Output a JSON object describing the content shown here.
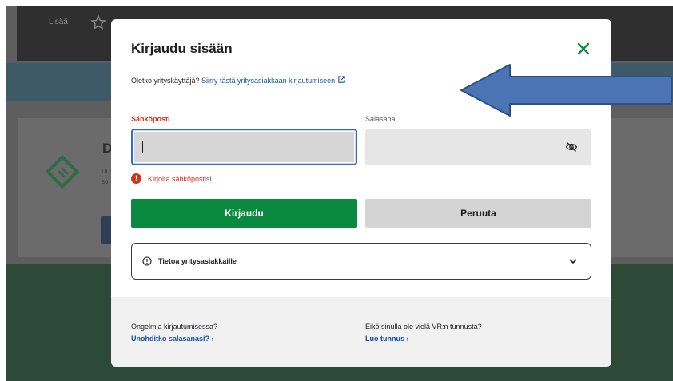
{
  "background": {
    "nav_label": "Lisää",
    "card_title": "D",
    "card_text": "Ui Eu so"
  },
  "modal": {
    "title": "Kirjaudu sisään",
    "close_icon": "close-x-icon",
    "business_prompt": "Oletko yrityskäyttäjä?",
    "business_link": "Siirry tästä yritysasiakkaan kirjautumiseen",
    "email_label": "Sähköposti",
    "email_value": "",
    "password_label": "Salasana",
    "password_value": "",
    "error_message": "Kirjoita sähköpostisi",
    "login_button": "Kirjaudu",
    "cancel_button": "Peruuta",
    "info_label": "Tietoa yritysasiakkaille",
    "footer": {
      "left_question": "Ongelmia kirjautumisessa?",
      "left_link": "Unohditko salasanasi? ›",
      "right_question": "Eikö sinulla ole vielä VR:n tunnusta?",
      "right_link": "Luo tunnus ›"
    }
  },
  "colors": {
    "primary_green": "#0a8a3e",
    "link_blue": "#1c4fa3",
    "error_red": "#d0321a",
    "focus_blue": "#2a6fd6",
    "arrow_fill": "#4a74b4"
  }
}
